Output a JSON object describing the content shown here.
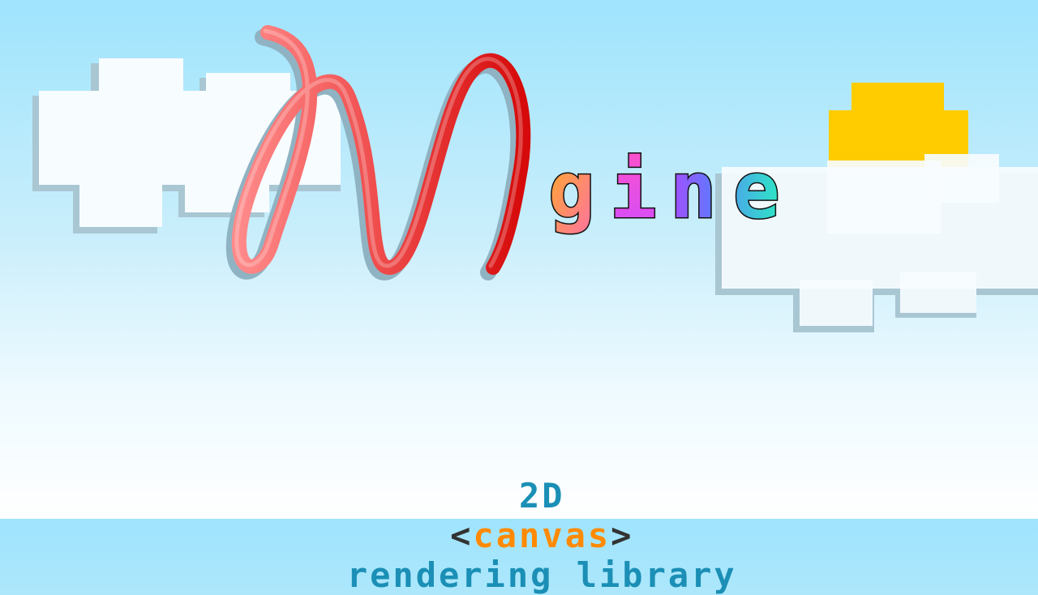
{
  "logo": {
    "letter": "M",
    "suffix": "gine",
    "letters": [
      "g",
      "i",
      "n",
      "e"
    ]
  },
  "tagline": {
    "part_2d": "2D",
    "lt": "<",
    "canvas": "canvas",
    "gt": ">",
    "rest": "rendering library"
  },
  "colors": {
    "sky_top": "#9fe4fd",
    "cloud": "#f7fcff",
    "cloud_shadow": "#a9c6d3",
    "sun": "#ffcc00",
    "m_stroke": "#e8343a",
    "tag_blue": "#1b8fb5",
    "tag_orange": "#ff8a00",
    "tag_dark": "#333333"
  },
  "icons": [
    "cloud-icon",
    "sun-icon",
    "logo-m-icon"
  ]
}
